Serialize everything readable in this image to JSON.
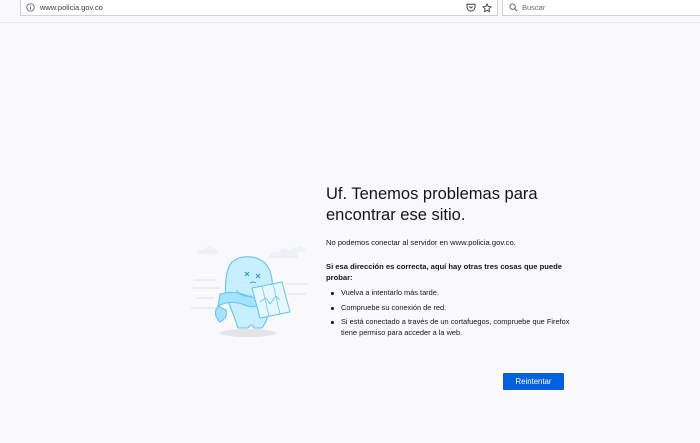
{
  "toolbar": {
    "url": "www.policia.gov.co",
    "search_placeholder": "Buscar"
  },
  "icons": {
    "info": "info-icon",
    "pocket": "pocket-icon",
    "bookmark": "star-icon",
    "search": "search-icon"
  },
  "error": {
    "title": "Uf. Tenemos problemas para encontrar ese sitio.",
    "description": "No podemos conectar al servidor en www.policia.gov.co.",
    "tips_heading": "Si esa dirección es correcta, aquí hay otras tres cosas que puede probar:",
    "tips": [
      "Vuelva a intentarlo más tarde.",
      "Compruebe su conexión de red.",
      "Si está conectado a través de un cortafuegos, compruebe que Firefox tiene permiso para acceder a la web."
    ],
    "retry_label": "Reintentar"
  },
  "colors": {
    "accent": "#0061e0",
    "background": "#f9f9fb",
    "illustration": "#92ddf6"
  }
}
